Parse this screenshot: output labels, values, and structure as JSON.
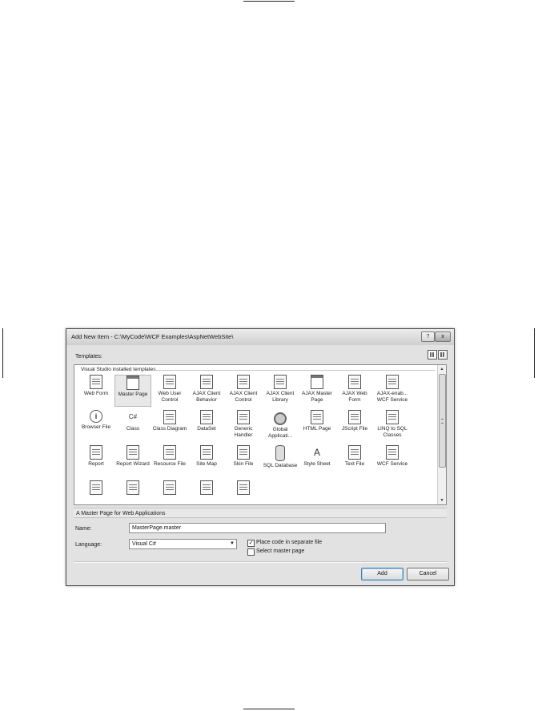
{
  "dialog": {
    "title": "Add New Item - C:\\MyCode\\WCF Examples\\AspNetWebSite\\",
    "help_label": "?",
    "close_label": "x"
  },
  "templates": {
    "label": "Templates:",
    "group_label": "Visual Studio installed templates",
    "items": [
      {
        "label": "Web Form",
        "icon": "web-form-icon"
      },
      {
        "label": "Master Page",
        "icon": "master-page-icon",
        "selected": true
      },
      {
        "label": "Web User Control",
        "icon": "web-user-control-icon"
      },
      {
        "label": "AJAX Client Behavior",
        "icon": "ajax-client-behavior-icon"
      },
      {
        "label": "AJAX Client Control",
        "icon": "ajax-client-control-icon"
      },
      {
        "label": "AJAX Client Library",
        "icon": "ajax-client-library-icon"
      },
      {
        "label": "AJAX Master Page",
        "icon": "ajax-master-page-icon"
      },
      {
        "label": "AJAX Web Form",
        "icon": "ajax-web-form-icon"
      },
      {
        "label": "AJAX-enab... WCF Service",
        "icon": "ajax-wcf-service-icon"
      },
      {
        "label": "Browser File",
        "icon": "browser-file-icon"
      },
      {
        "label": "Class",
        "icon": "class-icon"
      },
      {
        "label": "Class Diagram",
        "icon": "class-diagram-icon"
      },
      {
        "label": "DataSet",
        "icon": "dataset-icon"
      },
      {
        "label": "Generic Handler",
        "icon": "generic-handler-icon"
      },
      {
        "label": "Global Applicati...",
        "icon": "global-application-icon"
      },
      {
        "label": "HTML Page",
        "icon": "html-page-icon"
      },
      {
        "label": "JScript File",
        "icon": "jscript-file-icon"
      },
      {
        "label": "LINQ to SQL Classes",
        "icon": "linq-to-sql-icon"
      },
      {
        "label": "Report",
        "icon": "report-icon"
      },
      {
        "label": "Report Wizard",
        "icon": "report-wizard-icon"
      },
      {
        "label": "Resource File",
        "icon": "resource-file-icon"
      },
      {
        "label": "Site Map",
        "icon": "site-map-icon"
      },
      {
        "label": "Skin File",
        "icon": "skin-file-icon"
      },
      {
        "label": "SQL Database",
        "icon": "sql-database-icon"
      },
      {
        "label": "Style Sheet",
        "icon": "style-sheet-icon"
      },
      {
        "label": "Text File",
        "icon": "text-file-icon"
      },
      {
        "label": "WCF Service",
        "icon": "wcf-service-icon"
      },
      {
        "label": "",
        "icon": "web-service-icon"
      },
      {
        "label": "",
        "icon": "web-config-icon"
      },
      {
        "label": "",
        "icon": "xml-file-icon"
      },
      {
        "label": "",
        "icon": "xml-schema-icon"
      },
      {
        "label": "",
        "icon": "xslt-file-icon"
      }
    ]
  },
  "description": "A Master Page for Web Applications",
  "form": {
    "name_label": "Name:",
    "name_value": "MasterPage.master",
    "language_label": "Language:",
    "language_value": "Visual C#",
    "place_code_label": "Place code in separate file",
    "place_code_checked": true,
    "select_master_label": "Select master page",
    "select_master_checked": false
  },
  "buttons": {
    "add": "Add",
    "cancel": "Cancel"
  }
}
